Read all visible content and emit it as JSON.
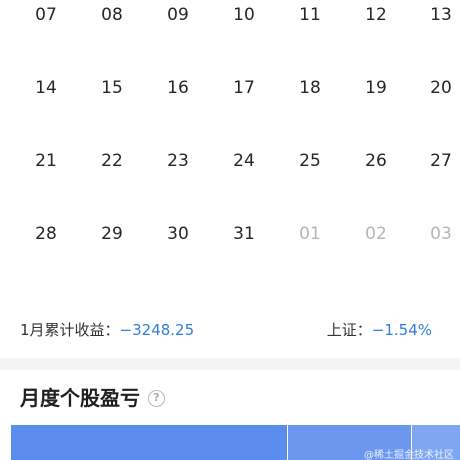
{
  "calendar": {
    "rows": [
      [
        {
          "day": "07",
          "other": false
        },
        {
          "day": "08",
          "other": false
        },
        {
          "day": "09",
          "other": false
        },
        {
          "day": "10",
          "other": false
        },
        {
          "day": "11",
          "other": false
        },
        {
          "day": "12",
          "other": false
        },
        {
          "day": "13",
          "other": false
        }
      ],
      [
        {
          "day": "14",
          "other": false
        },
        {
          "day": "15",
          "other": false
        },
        {
          "day": "16",
          "other": false
        },
        {
          "day": "17",
          "other": false
        },
        {
          "day": "18",
          "other": false
        },
        {
          "day": "19",
          "other": false
        },
        {
          "day": "20",
          "other": false
        }
      ],
      [
        {
          "day": "21",
          "other": false
        },
        {
          "day": "22",
          "other": false
        },
        {
          "day": "23",
          "other": false
        },
        {
          "day": "24",
          "other": false
        },
        {
          "day": "25",
          "other": false
        },
        {
          "day": "26",
          "other": false
        },
        {
          "day": "27",
          "other": false
        }
      ],
      [
        {
          "day": "28",
          "other": false
        },
        {
          "day": "29",
          "other": false
        },
        {
          "day": "30",
          "other": false
        },
        {
          "day": "31",
          "other": false
        },
        {
          "day": "01",
          "other": true
        },
        {
          "day": "02",
          "other": true
        },
        {
          "day": "03",
          "other": true
        }
      ]
    ]
  },
  "summary": {
    "cumulative_label": "1月累计收益：",
    "cumulative_value": "−3248.25",
    "index_label": "上证：",
    "index_value": "−1.54%"
  },
  "section": {
    "title": "月度个股盈亏",
    "help_icon": "help-circle-icon"
  },
  "treemap": {
    "colors": [
      "#5b8def",
      "#6b97ef",
      "#7fa6f0"
    ]
  },
  "watermark": "@稀土掘金技术社区"
}
